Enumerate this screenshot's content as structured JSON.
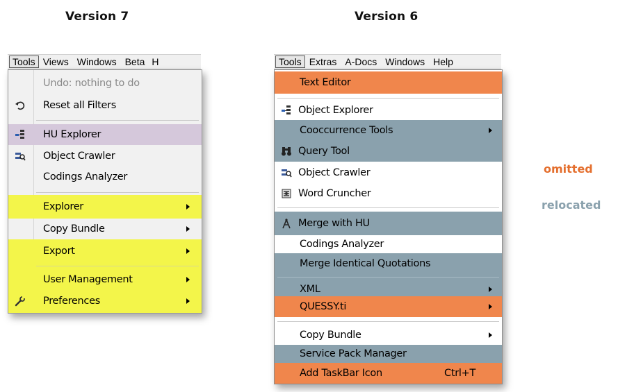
{
  "headings": {
    "v7": "Version 7",
    "v6": "Version 6"
  },
  "colors": {
    "omitted": "#f0864c",
    "relocated": "#8aa1ad",
    "highlight_yellow": "#f3f54a",
    "hover_purple": "#d5c8db"
  },
  "v7": {
    "menubar": [
      "Tools",
      "Views",
      "Windows",
      "Beta",
      "H"
    ],
    "items": {
      "undo": "Undo: nothing to do",
      "reset": "Reset all Filters",
      "hu_explorer": "HU Explorer",
      "object_crawler": "Object Crawler",
      "codings_analyzer": "Codings Analyzer",
      "explorer": "Explorer",
      "copy_bundle": "Copy Bundle",
      "export": "Export",
      "user_management": "User Management",
      "preferences": "Preferences"
    }
  },
  "v6": {
    "menubar": [
      "Tools",
      "Extras",
      "A-Docs",
      "Windows",
      "Help"
    ],
    "items": {
      "text_editor": "Text Editor",
      "object_explorer": "Object Explorer",
      "cooccurrence_tools": "Cooccurrence Tools",
      "query_tool": "Query Tool",
      "object_crawler": "Object Crawler",
      "word_cruncher": "Word Cruncher",
      "merge_with_hu": "Merge with HU",
      "codings_analyzer": "Codings Analyzer",
      "merge_identical": "Merge Identical Quotations",
      "xml": "XML",
      "quessy": "QUESSY.ti",
      "copy_bundle": "Copy Bundle",
      "service_pack": "Service Pack Manager",
      "add_taskbar": "Add TaskBar Icon",
      "add_taskbar_shortcut": "Ctrl+T"
    }
  },
  "legend": {
    "omitted": "omitted",
    "relocated": "relocated"
  }
}
